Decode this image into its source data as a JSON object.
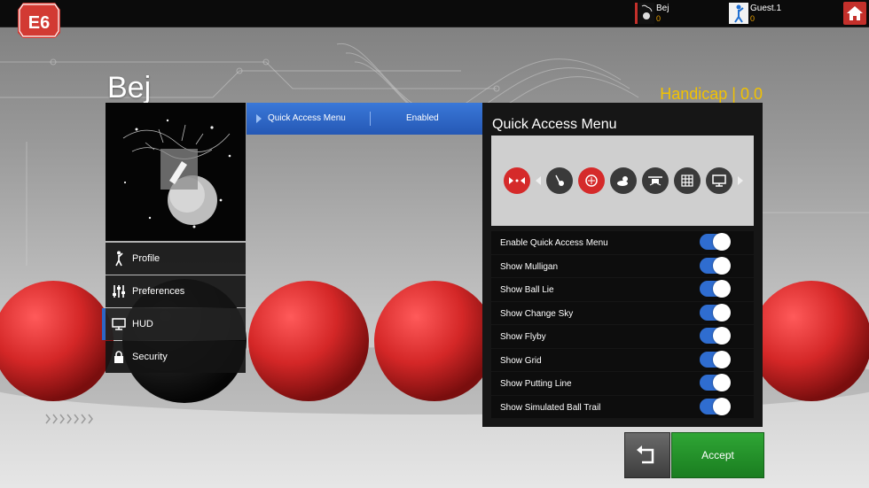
{
  "topbar": {
    "brand": "E6",
    "players": [
      {
        "name": "Bej",
        "score": "0"
      },
      {
        "name": "Guest.1",
        "score": "0"
      }
    ],
    "home_icon": "home-icon"
  },
  "profile": {
    "user_name": "Bej",
    "handicap": "Handicap | 0.0"
  },
  "menu": {
    "items": [
      {
        "label": "Profile",
        "icon": "golfer-icon"
      },
      {
        "label": "Preferences",
        "icon": "sliders-icon"
      },
      {
        "label": "HUD",
        "icon": "monitor-icon",
        "active": true
      },
      {
        "label": "Security",
        "icon": "lock-icon"
      }
    ]
  },
  "quick_access_tab": {
    "label": "Quick Access Menu",
    "value": "Enabled"
  },
  "panel": {
    "title": "Quick Access Menu",
    "preview_icons": [
      "mulligan-icon",
      "ball-lie-icon",
      "change-sky-icon",
      "weather-icon",
      "flyby-icon",
      "grid-icon",
      "screen-icon"
    ],
    "options": [
      {
        "label": "Enable Quick Access Menu",
        "on": true
      },
      {
        "label": "Show Mulligan",
        "on": true
      },
      {
        "label": "Show Ball Lie",
        "on": true
      },
      {
        "label": "Show Change Sky",
        "on": true
      },
      {
        "label": "Show Flyby",
        "on": true
      },
      {
        "label": "Show Grid",
        "on": true
      },
      {
        "label": "Show Putting Line",
        "on": true
      },
      {
        "label": "Show Simulated Ball Trail",
        "on": true
      }
    ]
  },
  "footer": {
    "accept_label": "Accept"
  },
  "colors": {
    "accent_blue": "#2f6dd0",
    "accept_green": "#22912a",
    "brand_red": "#c4302b",
    "handicap_gold": "#f2c200"
  }
}
